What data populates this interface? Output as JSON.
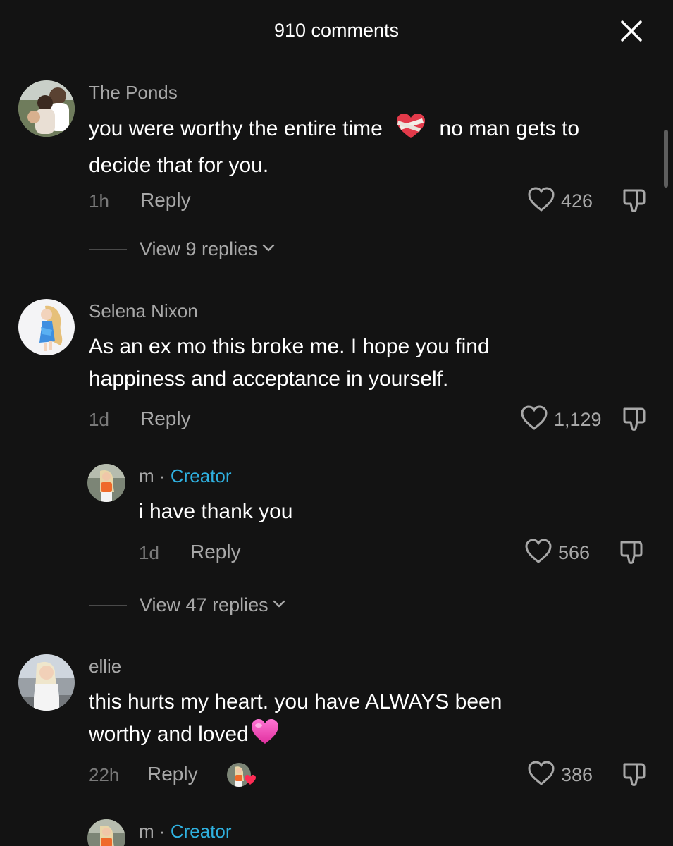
{
  "header": {
    "title": "910 comments",
    "close_icon": "close-icon"
  },
  "comments": [
    {
      "username": "The Ponds",
      "text_part1": "you were worthy the entire time",
      "emoji": "mending-heart-emoji",
      "text_part2": "no man gets to",
      "text_line2": "decide that for you.",
      "time": "1h",
      "reply": "Reply",
      "likes": "426",
      "view_replies": "View 9 replies"
    },
    {
      "username": "Selena Nixon",
      "text_line1": "As an ex mo this broke me. I hope you find",
      "text_line2": "happiness and acceptance in yourself.",
      "time": "1d",
      "reply": "Reply",
      "likes": "1,129"
    },
    {
      "username": "m",
      "separator": "·",
      "badge": "Creator",
      "text": "i have thank you",
      "time": "1d",
      "reply": "Reply",
      "likes": "566",
      "view_replies": "View 47 replies"
    },
    {
      "username": "ellie",
      "text_line1": "this hurts my heart. you have ALWAYS been",
      "text_line2": "worthy and loved",
      "emoji": "pink-heart-emoji",
      "time": "22h",
      "reply": "Reply",
      "creator_liked": true,
      "likes": "386"
    },
    {
      "username": "m",
      "separator": "·",
      "badge": "Creator"
    }
  ],
  "colors": {
    "background": "#131313",
    "creator_badge": "#2fb1e0",
    "muted_text": "#a8a8a8",
    "time_text": "#7a7a7a"
  }
}
